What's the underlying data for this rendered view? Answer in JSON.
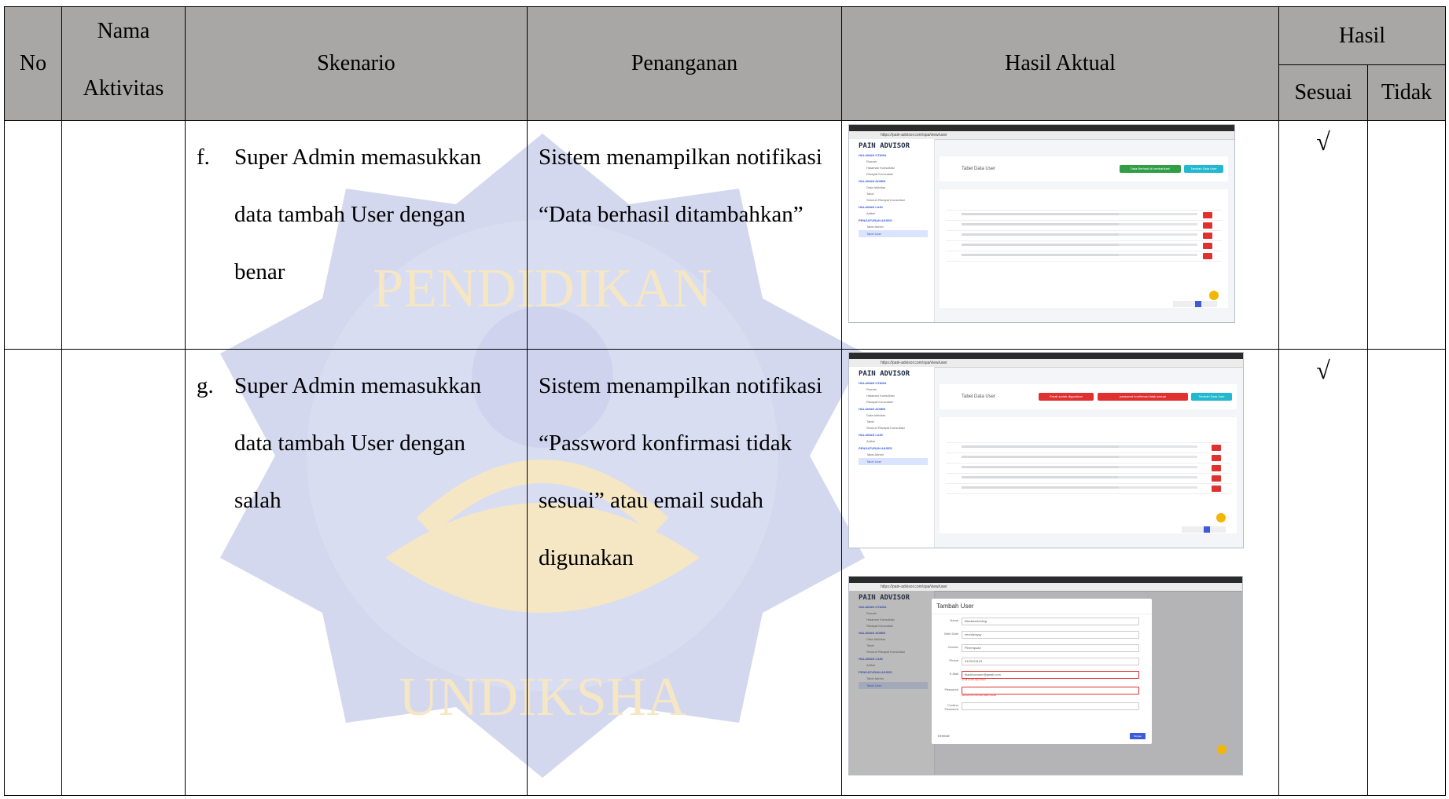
{
  "header": {
    "no": "No",
    "nama_aktivitas": "Nama\nAktivitas",
    "skenario": "Skenario",
    "penanganan": "Penanganan",
    "hasil_aktual": "Hasil Aktual",
    "hasil": "Hasil",
    "sesuai": "Sesuai",
    "tidak": "Tidak"
  },
  "rows": [
    {
      "no": "",
      "nama_aktivitas": "",
      "skenario_label": "f.",
      "skenario": "Super Admin memasukkan data tambah User dengan benar",
      "penanganan": "Sistem menampilkan notifikasi “Data berhasil ditambahkan”",
      "sesuai": "√",
      "tidak": ""
    },
    {
      "no": "",
      "nama_aktivitas": "",
      "skenario_label": "g.",
      "skenario": "Super Admin memasukkan data tambah User dengan salah",
      "penanganan": "Sistem menampilkan notifikasi “Password konfirmasi tidak sesuai” atau email sudah digunakan",
      "sesuai": "√",
      "tidak": ""
    }
  ],
  "screenshot": {
    "app_logo": "PAIN ADVISOR",
    "url": "https://pain-advisor.com/spa/view/user",
    "page_title": "Tabel Data User",
    "add_button": "Tambah Data User",
    "success_badge": "Data Berhasil di tambahkan!",
    "error_badge_email": "Email sudah digunakan",
    "error_badge_password": "password konfirmasi tidak sesuai",
    "sidebar_sections": [
      "HALAMAN UTAMA",
      "HALAMAN ADMIN",
      "HALAMAN LAIN",
      "PENGATURAN AKSES"
    ],
    "sidebar_items": [
      "Rumah",
      "Halaman Konsultasi",
      "Riwayat Konsultasi",
      "Data Aktivitas",
      "Tabel",
      "Seluruh Riwayat Konsultasi",
      "Artikel",
      "Tabel Admin",
      "Tabel User"
    ],
    "modal_title": "Tambah User",
    "modal_fields": [
      {
        "label": "Name",
        "value": "Blackboxtesting"
      },
      {
        "label": "Birth Date",
        "value": "mm/dd/yyyy"
      },
      {
        "label": "Gender",
        "value": "Perempuan"
      },
      {
        "label": "Phone",
        "value": "3123123123"
      },
      {
        "label": "E-Mail",
        "value": "blackboxuser@gmail.com",
        "error": "email sudah digunakan"
      },
      {
        "label": "Password",
        "value": "",
        "error": "password konfirmasi tidak sesuai"
      },
      {
        "label": "Confirm Password",
        "value": ""
      }
    ],
    "modal_back": "Kembali",
    "modal_save": "Simpan"
  },
  "watermark_text": "UNIVERSITAS PENDIDIKAN GANESHA · UNDIKSHA",
  "colors": {
    "header_bg": "#a9a6a6",
    "watermark_blue": "#6b78c8",
    "watermark_gold": "#e2b24a"
  }
}
